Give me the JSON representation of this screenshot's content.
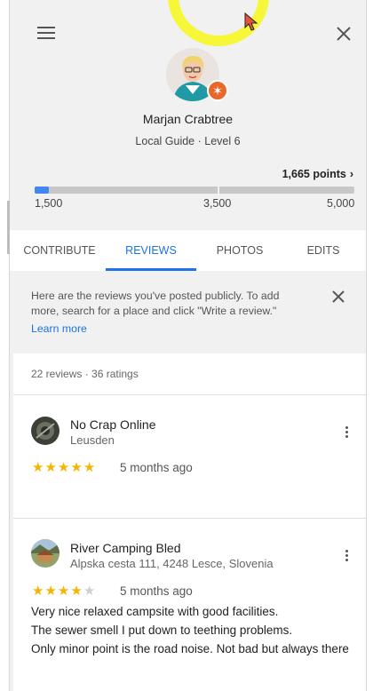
{
  "profile": {
    "name": "Marjan Crabtree",
    "level": "Local Guide · Level 6",
    "points": "1,665 points",
    "points_chevron": "›"
  },
  "progress": {
    "fraction_of_first_segment": 0.08,
    "ticks": [
      "1,500",
      "3,500",
      "5,000"
    ],
    "accent": "#4285f4"
  },
  "tabs": [
    {
      "label": "CONTRIBUTE"
    },
    {
      "label": "REVIEWS"
    },
    {
      "label": "PHOTOS"
    },
    {
      "label": "EDITS"
    }
  ],
  "notice": {
    "text": "Here are the reviews you've posted publicly. To add more, search for a place and click \"Write a review.\"",
    "link": "Learn more"
  },
  "summary": "22 reviews · 36 ratings",
  "reviews": [
    {
      "title": "No Crap Online",
      "subtitle": "Leusden",
      "stars": 5,
      "time": "5 months ago",
      "text": ""
    },
    {
      "title": "River Camping Bled",
      "subtitle": "Alpska cesta 111, 4248 Lesce, Slovenia",
      "stars": 4,
      "time": "5 months ago",
      "text": "Very nice relaxed campsite with good facilities.\nThe sewer smell I put down to teething problems.\nOnly minor point is the road noise. Not bad but always there"
    }
  ],
  "icons": {
    "menu": "hamburger-menu-icon",
    "close": "close-icon",
    "badge": "local-guide-star-icon",
    "more": "more-vert-icon"
  },
  "colors": {
    "accent": "#1a73e8",
    "star": "#f4b400",
    "badge": "#e8672a"
  }
}
